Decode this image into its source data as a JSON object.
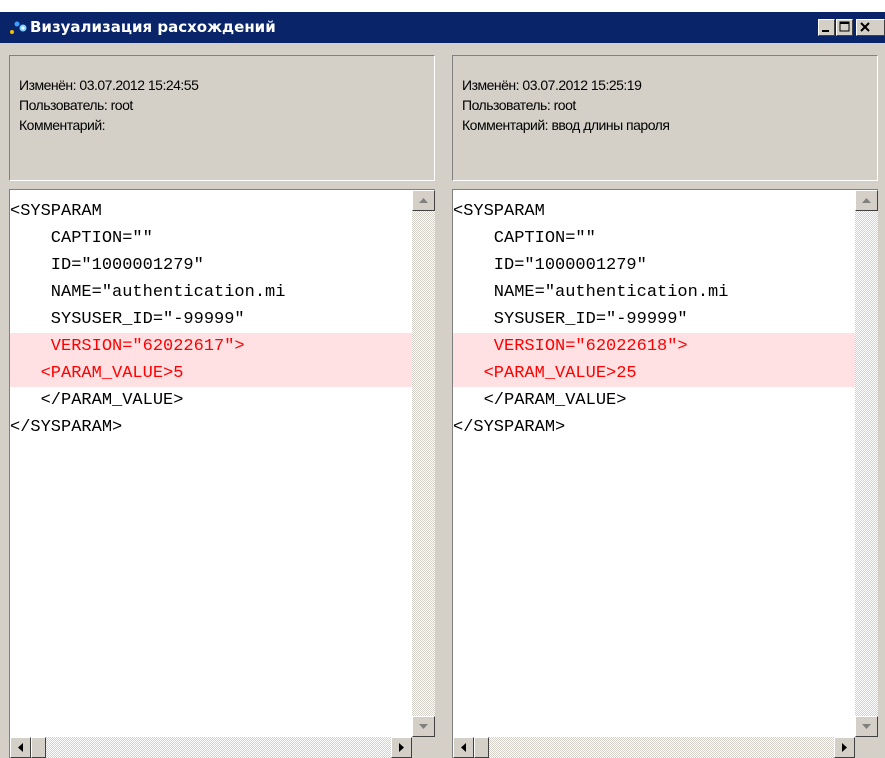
{
  "window": {
    "title": "Визуализация расхождений",
    "diff_bg_color": "#ffe0e3",
    "diff_text_color": "#ff0000",
    "title_bar_color": "#0a246a",
    "controls": [
      "minimize-icon",
      "maximize-icon",
      "close-icon"
    ]
  },
  "left": {
    "modified": "Изменён: 03.07.2012 15:24:55",
    "user": "Пользователь: root",
    "comment": "Комментарий:",
    "lines": [
      "<SYSPARAM",
      "    CAPTION=\"\"",
      "    ID=\"1000001279\"",
      "    NAME=\"authentication.mi",
      "    SYSUSER_ID=\"-99999\"",
      "    VERSION=\"62022617\">",
      "   <PARAM_VALUE>5",
      "   </PARAM_VALUE>",
      "</SYSPARAM>"
    ]
  },
  "right": {
    "modified": "Изменён: 03.07.2012 15:25:19",
    "user": "Пользователь: root",
    "comment": "Комментарий: ввод длины пароля",
    "lines": [
      "<SYSPARAM",
      "    CAPTION=\"\"",
      "    ID=\"1000001279\"",
      "    NAME=\"authentication.mi",
      "    SYSUSER_ID=\"-99999\"",
      "    VERSION=\"62022618\">",
      "   <PARAM_VALUE>25",
      "   </PARAM_VALUE>",
      "</SYSPARAM>"
    ]
  }
}
